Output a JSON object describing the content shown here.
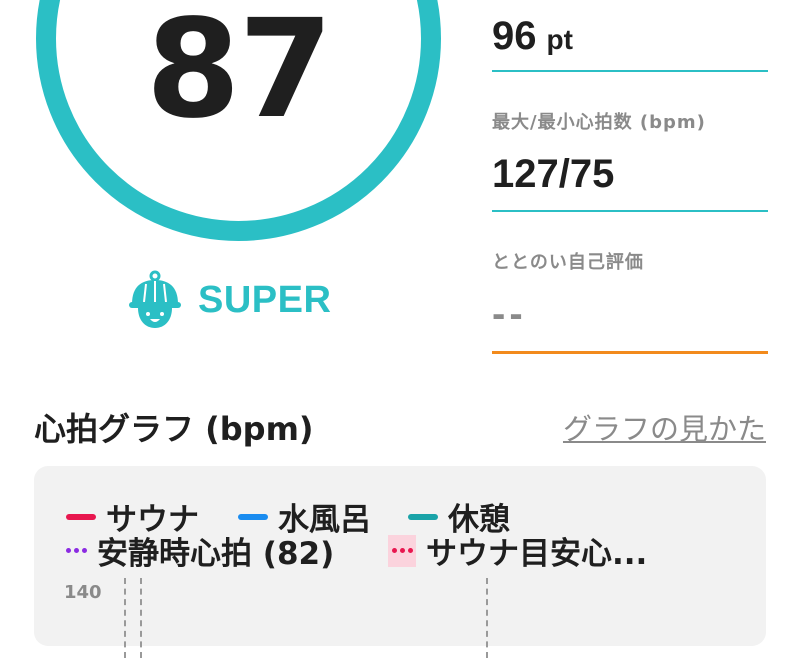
{
  "score": {
    "value": "87",
    "rank": "SUPER",
    "ring_color": "#2bbfc5"
  },
  "stats": {
    "points": {
      "value": "96",
      "unit": "pt"
    },
    "heart_rate": {
      "label": "最大/最小心拍数 (bpm)",
      "value": "127/75"
    },
    "self_eval": {
      "label": "ととのい自己評価",
      "value": "--"
    }
  },
  "graph": {
    "title": "心拍グラフ (bpm)",
    "help_link": "グラフの見かた",
    "legend": [
      {
        "label": "サウナ",
        "color": "#e8174f",
        "style": "line"
      },
      {
        "label": "水風呂",
        "color": "#1a8cf0",
        "style": "line"
      },
      {
        "label": "休憩",
        "color": "#1aa3a8",
        "style": "line"
      },
      {
        "label": "安静時心拍 (82)",
        "color": "#8b2be2",
        "style": "dotted"
      },
      {
        "label": "サウナ目安心...",
        "color": "#e8174f",
        "style": "zone"
      }
    ],
    "y_tick_top": "140"
  },
  "icons": {
    "rank_icon": "sauna-hat-face-icon"
  }
}
